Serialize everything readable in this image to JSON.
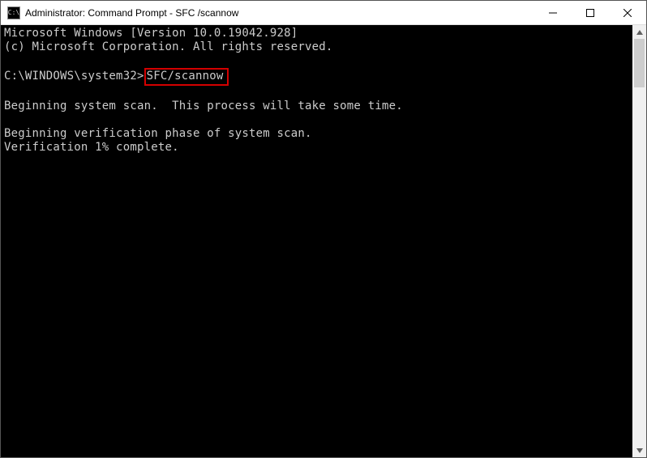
{
  "window": {
    "icon_text": "C:\\",
    "title": "Administrator: Command Prompt - SFC /scannow"
  },
  "terminal": {
    "line1": "Microsoft Windows [Version 10.0.19042.928]",
    "line2": "(c) Microsoft Corporation. All rights reserved.",
    "blank1": "",
    "prompt": "C:\\WINDOWS\\system32>",
    "command": "SFC/scannow",
    "blank2": "",
    "scan1": "Beginning system scan.  This process will take some time.",
    "blank3": "",
    "scan2": "Beginning verification phase of system scan.",
    "scan3": "Verification 1% complete."
  }
}
